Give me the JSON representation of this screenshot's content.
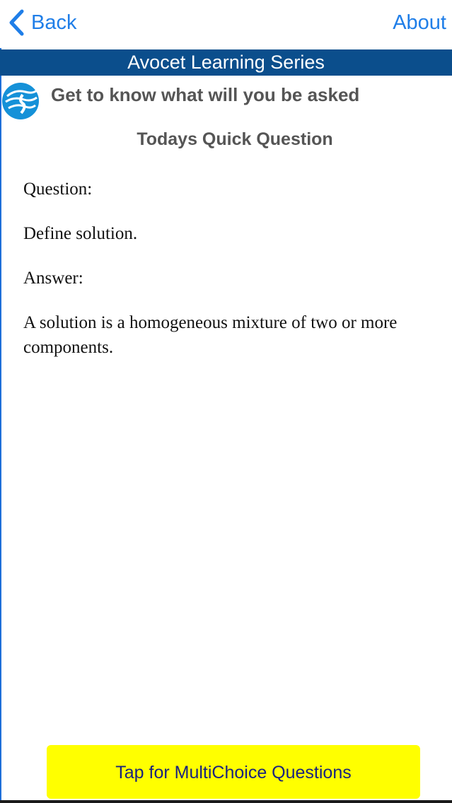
{
  "nav": {
    "back_label": "Back",
    "about_label": "About"
  },
  "banner": {
    "title": "Avocet Learning Series"
  },
  "header": {
    "tagline": "Get to know what will you be asked",
    "section_title": "Todays Quick Question"
  },
  "qa": {
    "question_heading": "Question:",
    "question_text": "Define solution.",
    "answer_heading": "Answer:",
    "answer_text": "A solution is a homogeneous mixture of two or more components."
  },
  "action": {
    "multichoice_label": "Tap for MultiChoice Questions"
  },
  "colors": {
    "link_blue": "#1f7ee8",
    "banner_blue": "#0b4e8c",
    "button_yellow": "#ffff00",
    "button_text": "#1a237e"
  },
  "icons": {
    "back": "chevron-left-icon",
    "logo": "avocet-logo-icon"
  }
}
